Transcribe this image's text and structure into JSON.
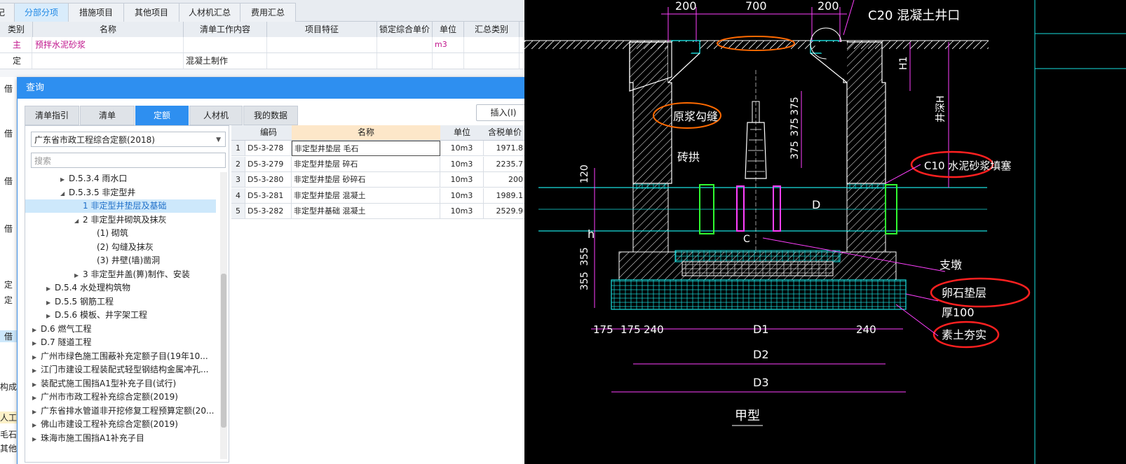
{
  "top_tabs": [
    "分部分项",
    "措施项目",
    "其他项目",
    "人材机汇总",
    "费用汇总"
  ],
  "main_grid": {
    "headers": [
      "类别",
      "名称",
      "清单工作内容",
      "项目特征",
      "锁定综合单价",
      "单位",
      "汇总类别"
    ],
    "rows": [
      {
        "type": "主",
        "name": "预拌水泥砂浆",
        "content": "",
        "feature": "",
        "lock": "",
        "unit": "m3",
        "sum": ""
      },
      {
        "type": "定",
        "name": "",
        "content": "混凝土制作",
        "feature": "",
        "lock": "",
        "unit": "",
        "sum": ""
      }
    ]
  },
  "side_labels": [
    "借",
    "借",
    "借",
    "借",
    "定",
    "定",
    "借"
  ],
  "bottom_left": [
    "构成",
    "人工",
    "毛石",
    "其他"
  ],
  "dialog": {
    "title": "查询",
    "tabs": [
      "清单指引",
      "清单",
      "定额",
      "人材机",
      "我的数据"
    ],
    "active_tab": "定额",
    "insert_label": "插入(I)",
    "quota_select": "广东省市政工程综合定额(2018)",
    "search_placeholder": "搜索",
    "tree": [
      {
        "label": "D.5.3.4 雨水口",
        "indent": 3,
        "arrow": "right"
      },
      {
        "label": "D.5.3.5 非定型井",
        "indent": 3,
        "arrow": "down"
      },
      {
        "label": "1 非定型井垫层及基础",
        "indent": 4,
        "arrow": "",
        "selected": true
      },
      {
        "label": "2 非定型井砌筑及抹灰",
        "indent": 4,
        "arrow": "down"
      },
      {
        "label": "(1) 砌筑",
        "indent": 5,
        "arrow": ""
      },
      {
        "label": "(2) 勾缝及抹灰",
        "indent": 5,
        "arrow": ""
      },
      {
        "label": "(3) 井壁(墙)凿洞",
        "indent": 5,
        "arrow": ""
      },
      {
        "label": "3 非定型井盖(箅)制作、安装",
        "indent": 4,
        "arrow": "right"
      },
      {
        "label": "D.5.4 水处理构筑物",
        "indent": 2,
        "arrow": "right"
      },
      {
        "label": "D.5.5 钢筋工程",
        "indent": 2,
        "arrow": "right"
      },
      {
        "label": "D.5.6 模板、井字架工程",
        "indent": 2,
        "arrow": "right"
      },
      {
        "label": "D.6 燃气工程",
        "indent": 1,
        "arrow": "right"
      },
      {
        "label": "D.7 隧道工程",
        "indent": 1,
        "arrow": "right"
      },
      {
        "label": "广州市绿色施工围蔽补充定额子目(19年10...",
        "indent": 1,
        "arrow": "right"
      },
      {
        "label": "江门市建设工程装配式轻型钢结构金属冲孔...",
        "indent": 1,
        "arrow": "right"
      },
      {
        "label": "装配式施工围挡A1型补充子目(试行)",
        "indent": 1,
        "arrow": "right"
      },
      {
        "label": "广州市市政工程补充综合定额(2019)",
        "indent": 1,
        "arrow": "right"
      },
      {
        "label": "广东省排水管道非开挖修复工程预算定额(20...",
        "indent": 1,
        "arrow": "right"
      },
      {
        "label": "佛山市建设工程补充综合定额(2019)",
        "indent": 1,
        "arrow": "right"
      },
      {
        "label": "珠海市施工围挡A1补充子目",
        "indent": 1,
        "arrow": "right"
      }
    ],
    "table": {
      "headers": [
        "",
        "编码",
        "名称",
        "单位",
        "含税单价"
      ],
      "rows": [
        {
          "n": "1",
          "code": "D5-3-278",
          "name": "非定型井垫层 毛石",
          "unit": "10m3",
          "price": "1971.8"
        },
        {
          "n": "2",
          "code": "D5-3-279",
          "name": "非定型井垫层 碎石",
          "unit": "10m3",
          "price": "2235.7"
        },
        {
          "n": "3",
          "code": "D5-3-280",
          "name": "非定型井垫层 砂碎石",
          "unit": "10m3",
          "price": "200"
        },
        {
          "n": "4",
          "code": "D5-3-281",
          "name": "非定型井垫层 混凝土",
          "unit": "10m3",
          "price": "1989.1"
        },
        {
          "n": "5",
          "code": "D5-3-282",
          "name": "非定型井基础 混凝土",
          "unit": "10m3",
          "price": "2529.9"
        }
      ]
    }
  },
  "cad": {
    "dims_top": [
      "200",
      "700",
      "200"
    ],
    "label_c20": "C20 混凝土井口",
    "label_yuanjiang": "原浆勾缝",
    "label_zhuanqi": "砖拱",
    "label_c10": "C10 水泥砂浆填塞",
    "label_zhidun": "支墩",
    "label_luanshi": "卵石垫层",
    "label_hou": "厚100",
    "label_sutu": "素土夯实",
    "label_jiaxing": "甲型",
    "label_D1": "D1",
    "label_D2": "D2",
    "label_D3": "D3",
    "label_D": "D",
    "label_C": "C",
    "label_H1": "H1",
    "label_h": "h",
    "dim_120": "120",
    "dim_175a": "175",
    "dim_175b": "175",
    "dim_240a": "240",
    "dim_240b": "240",
    "dim_355a": "355",
    "dim_355b": "355",
    "dim_375a": "375",
    "dim_375b": "375",
    "dim_375c": "375",
    "label_jingshen": "井深H"
  }
}
